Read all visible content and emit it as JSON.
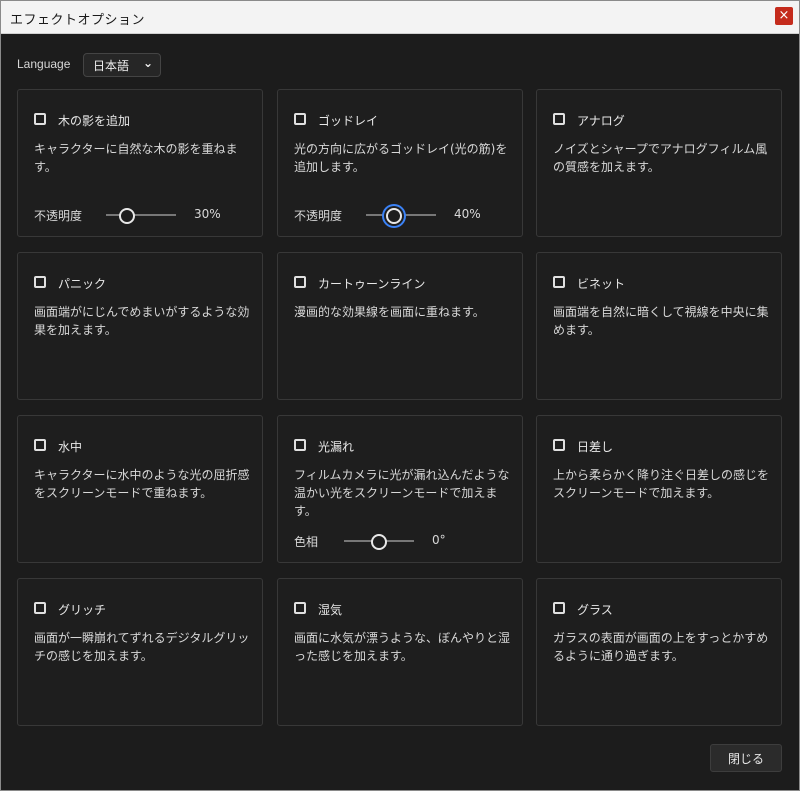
{
  "window": {
    "title": "エフェクトオプション",
    "close_glyph": "×"
  },
  "language": {
    "label": "Language",
    "selected": "日本語",
    "chevron": "⌄"
  },
  "cards": [
    {
      "title": "木の影を追加",
      "desc": "キャラクターに自然な木の影を重ねます。",
      "checked": false,
      "slider": {
        "label": "不透明度",
        "value": 0.3,
        "value_text": "30%"
      }
    },
    {
      "title": "ゴッドレイ",
      "desc": "光の方向に広がるゴッドレイ(光の筋)を追加します。",
      "checked": false,
      "slider": {
        "label": "不透明度",
        "value": 0.4,
        "value_text": "40%",
        "focused": true
      }
    },
    {
      "title": "アナログ",
      "desc": "ノイズとシャープでアナログフィルム風の質感を加えます。",
      "checked": false
    },
    {
      "title": "パニック",
      "desc": "画面端がにじんでめまいがするような効果を加えます。",
      "checked": false
    },
    {
      "title": "カートゥーンライン",
      "desc": "漫画的な効果線を画面に重ねます。",
      "checked": false
    },
    {
      "title": "ビネット",
      "desc": "画面端を自然に暗くして視線を中央に集めます。",
      "checked": false
    },
    {
      "title": "水中",
      "desc": "キャラクターに水中のような光の屈折感をスクリーンモードで重ねます。",
      "checked": false
    },
    {
      "title": "光漏れ",
      "desc": "フィルムカメラに光が漏れ込んだような温かい光をスクリーンモードで加えます。",
      "checked": false,
      "slider": {
        "label": "色相",
        "value": 0.5,
        "value_text": "0°"
      }
    },
    {
      "title": "日差し",
      "desc": "上から柔らかく降り注ぐ日差しの感じをスクリーンモードで加えます。",
      "checked": false
    },
    {
      "title": "グリッチ",
      "desc": "画面が一瞬崩れてずれるデジタルグリッチの感じを加えます。",
      "checked": false
    },
    {
      "title": "湿気",
      "desc": "画面に水気が漂うような、ぼんやりと湿った感じを加えます。",
      "checked": false
    },
    {
      "title": "グラス",
      "desc": "ガラスの表面が画面の上をすっとかすめるように通り過ぎます。",
      "checked": false
    }
  ],
  "footer": {
    "close_label": "閉じる"
  }
}
